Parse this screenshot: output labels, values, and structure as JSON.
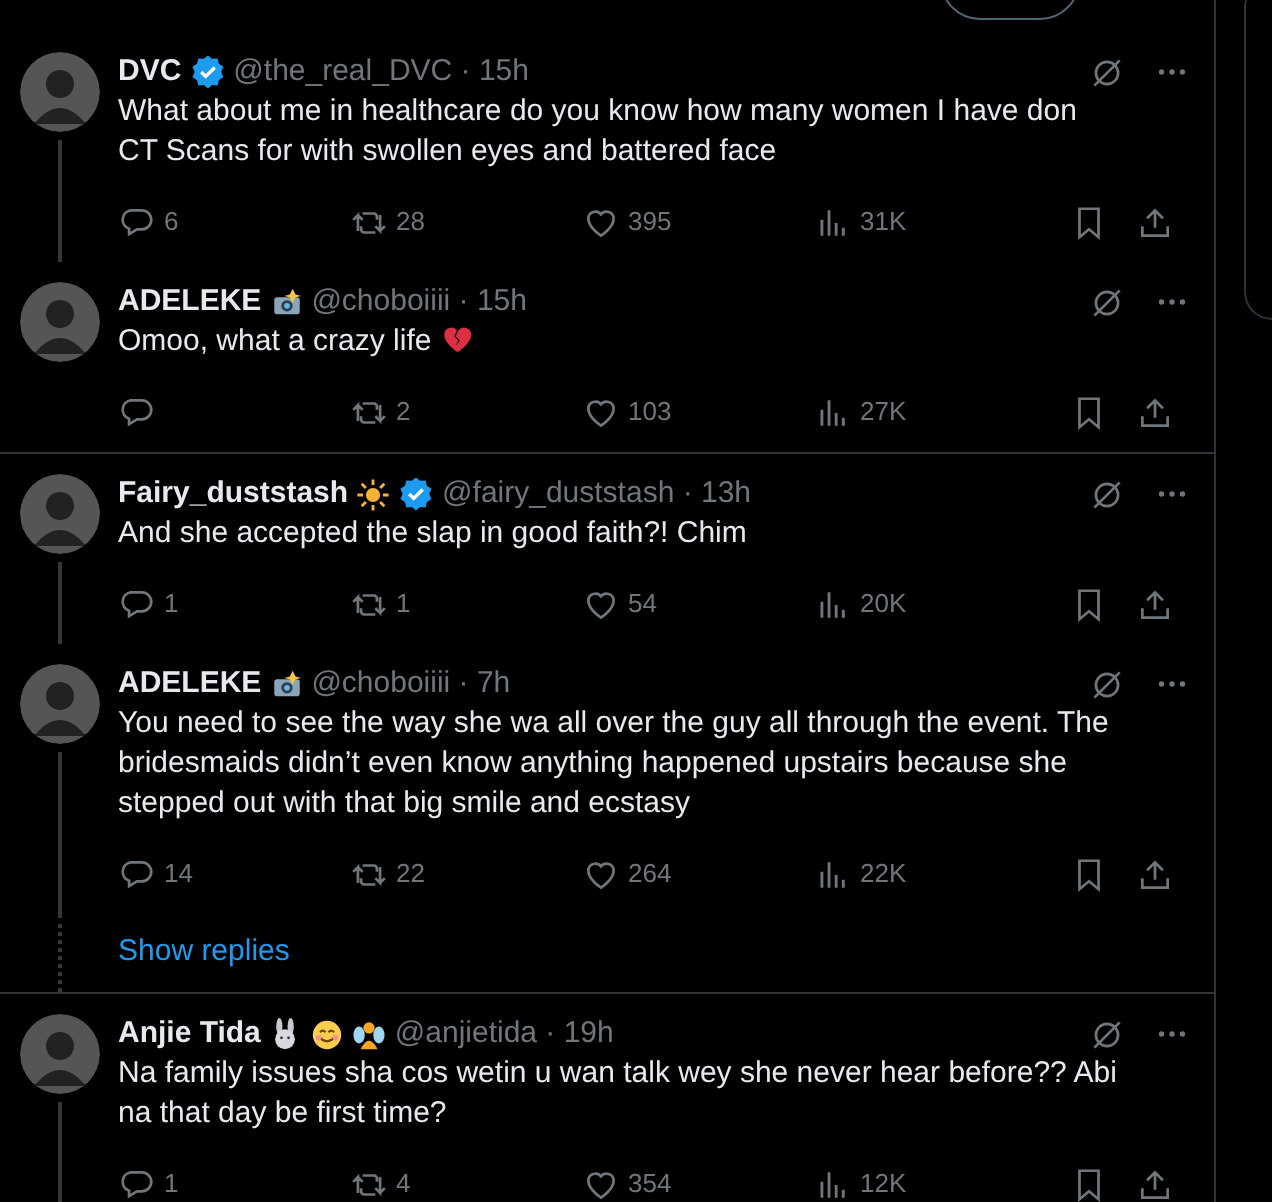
{
  "thread": [
    {
      "name": "DVC",
      "verified": true,
      "meta": "@the_real_DVC · 15h",
      "text": "What about me in healthcare do you know how many women I have don CT Scans for with swollen eyes and battered face",
      "counts": {
        "replies": "6",
        "reposts": "28",
        "likes": "395",
        "views": "31K"
      },
      "thread_line": true,
      "divider": false
    },
    {
      "name": "ADELEKE",
      "badges": [
        {
          "kind": "camera"
        }
      ],
      "verified": false,
      "meta": "@choboiiii · 15h",
      "text": "Omoo, what a crazy life",
      "text_icons": [
        {
          "kind": "broken-heart"
        }
      ],
      "counts": {
        "reposts": "2",
        "likes": "103",
        "views": "27K"
      },
      "thread_line": false,
      "divider": true
    },
    {
      "name": "Fairy_duststash",
      "badges": [
        {
          "kind": "sun"
        }
      ],
      "verified": true,
      "meta": "@fairy_duststash · 13h",
      "text": "And she accepted the slap in good faith?! Chim",
      "counts": {
        "replies": "1",
        "reposts": "1",
        "likes": "54",
        "views": "20K"
      },
      "thread_line": true,
      "divider": false
    },
    {
      "name": "ADELEKE",
      "badges": [
        {
          "kind": "camera"
        }
      ],
      "verified": false,
      "meta": "@choboiiii · 7h",
      "text": "You need to see the way she wa all over the guy all through the event. The bridesmaids didn’t even know anything happened upstairs because she stepped out with that big smile and ecstasy",
      "counts": {
        "replies": "14",
        "reposts": "22",
        "likes": "264",
        "views": "22K"
      },
      "thread_line": true,
      "divider": false,
      "show_replies": "Show replies"
    },
    {
      "name": "Anjie Tida",
      "badges": [
        {
          "kind": "rabbit"
        },
        {
          "kind": "smile"
        },
        {
          "kind": "fairy"
        }
      ],
      "verified": false,
      "meta": "@anjietida · 19h",
      "text": "Na family issues sha cos wetin u wan talk wey she never hear before?? Abi na that day be first time?",
      "counts": {
        "replies": "1",
        "reposts": "4",
        "likes": "354",
        "views": "12K"
      },
      "thread_line": true,
      "divider": false
    }
  ]
}
